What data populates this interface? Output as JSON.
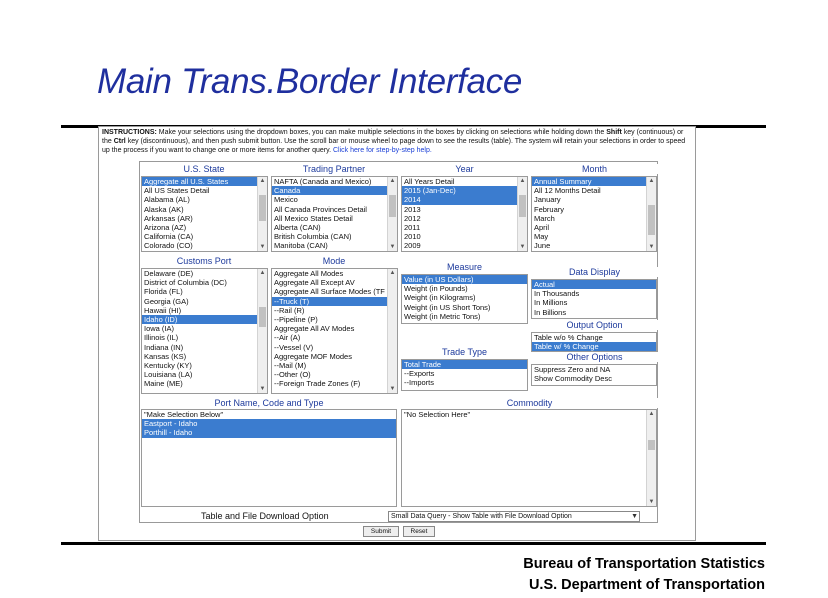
{
  "slide": {
    "title": "Main Trans.Border Interface",
    "credit_line1": "Bureau of Transportation Statistics",
    "credit_line2": "U.S. Department of Transportation"
  },
  "instructions": {
    "label": "INSTRUCTIONS:",
    "text1": " Make your selections using the dropdown boxes, you can make multiple selections in the boxes by clicking on selections while holding down the ",
    "shift": "Shift",
    "text2": " key (continuous) or the ",
    "ctrl": "Ctrl",
    "text3": " key (discontinuous), and then push submit button. Use the scroll bar or mouse wheel to page down to see the results (table). The system will retain your selections in order to speed up the process if you want to change one or more items for another query. ",
    "link": "Click here for step-by-step help."
  },
  "panels": {
    "us_state": {
      "header": "U.S. State",
      "options": [
        "Aggregate all U.S. States",
        "All US States Detail",
        "Alabama (AL)",
        "Alaska (AK)",
        "Arkansas (AR)",
        "Arizona (AZ)",
        "California (CA)",
        "Colorado (CO)"
      ],
      "selected": [
        0
      ]
    },
    "trading_partner": {
      "header": "Trading Partner",
      "options": [
        "NAFTA (Canada and Mexico)",
        "Canada",
        "Mexico",
        "All Canada Provinces Detail",
        "All Mexico States Detail",
        "Alberta (CAN)",
        "British Columbia (CAN)",
        "Manitoba (CAN)"
      ],
      "selected": [
        1
      ]
    },
    "year": {
      "header": "Year",
      "options": [
        "All Years Detail",
        "2015 (Jan-Dec)",
        "2014",
        "2013",
        "2012",
        "2011",
        "2010",
        "2009"
      ],
      "selected": [
        1,
        2
      ]
    },
    "month": {
      "header": "Month",
      "options": [
        "Annual Summary",
        "All 12 Months Detail",
        "January",
        "February",
        "March",
        "April",
        "May",
        "June"
      ],
      "selected": [
        0
      ]
    },
    "customs_port": {
      "header": "Customs Port",
      "options": [
        "Delaware (DE)",
        "District of Columbia (DC)",
        "Florida (FL)",
        "Georgia (GA)",
        "Hawaii (HI)",
        "Idaho (ID)",
        "Iowa (IA)",
        "Illinois (IL)",
        "Indiana (IN)",
        "Kansas (KS)",
        "Kentucky (KY)",
        "Louisiana (LA)",
        "Maine (ME)"
      ],
      "selected": [
        5
      ]
    },
    "mode": {
      "header": "Mode",
      "options": [
        "Aggregate All Modes",
        "Aggregate All Except AV",
        "Aggregate All Surface Modes (TF",
        "--Truck (T)",
        "--Rail (R)",
        "--Pipeline (P)",
        "Aggregate All AV Modes",
        "--Air (A)",
        "--Vessel (V)",
        "Aggregate MOF Modes",
        "--Mail (M)",
        "--Other (O)",
        "--Foreign Trade Zones (F)"
      ],
      "selected": [
        3
      ]
    },
    "measure": {
      "header": "Measure",
      "options": [
        "Value (in US Dollars)",
        "Weight (in Pounds)",
        "Weight (in Kilograms)",
        "Weight (in US Short Tons)",
        "Weight (in Metric Tons)"
      ],
      "selected": [
        0
      ]
    },
    "trade_type": {
      "header": "Trade Type",
      "options": [
        "Total Trade",
        "--Exports",
        "--Imports"
      ],
      "selected": [
        0
      ]
    },
    "data_display": {
      "header": "Data Display",
      "options": [
        "Actual",
        "In Thousands",
        "In Millions",
        "In Billions"
      ],
      "selected": [
        0
      ]
    },
    "output_option": {
      "header": "Output Option",
      "options": [
        "Table w/o % Change",
        "Table w/ % Change"
      ],
      "selected": [
        1
      ]
    },
    "other_options": {
      "header": "Other Options",
      "options": [
        "Suppress Zero and NA",
        "Show Commodity Desc"
      ],
      "selected": []
    },
    "port_name": {
      "header": "Port Name, Code and Type",
      "options": [
        "\"Make Selection Below\"",
        "Eastport - Idaho",
        "Porthill - Idaho"
      ],
      "selected": [
        1,
        2
      ]
    },
    "commodity": {
      "header": "Commodity",
      "options": [
        "\"No Selection Here\""
      ],
      "selected": []
    }
  },
  "download": {
    "label": "Table and File Download Option",
    "value": "Small Data Query - Show Table with File Download Option"
  },
  "buttons": {
    "submit": "Submit",
    "reset": "Reset"
  }
}
